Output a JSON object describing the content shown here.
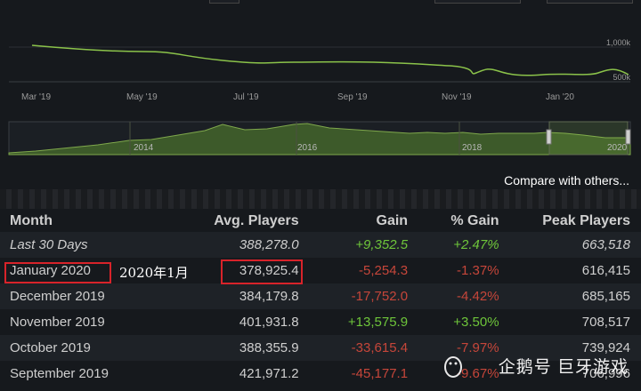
{
  "chart": {
    "yaxis_labels": [
      "1,000k",
      "500k"
    ],
    "xaxis_labels": [
      "Mar '19",
      "May '19",
      "Jul '19",
      "Sep '19",
      "Nov '19",
      "Jan '20"
    ],
    "navigator_labels": [
      "2014",
      "2016",
      "2018",
      "2020"
    ],
    "line_color": "#8bc34a"
  },
  "compare_link": "Compare with others...",
  "table": {
    "headers": [
      "Month",
      "Avg. Players",
      "Gain",
      "% Gain",
      "Peak Players"
    ],
    "rows": [
      {
        "month": "Last 30 Days",
        "avg": "388,278.0",
        "gain": "+9,352.5",
        "pct": "+2.47%",
        "peak": "663,518"
      },
      {
        "month": "January 2020",
        "avg": "378,925.4",
        "gain": "-5,254.3",
        "pct": "-1.37%",
        "peak": "616,415"
      },
      {
        "month": "December 2019",
        "avg": "384,179.8",
        "gain": "-17,752.0",
        "pct": "-4.42%",
        "peak": "685,165"
      },
      {
        "month": "November 2019",
        "avg": "401,931.8",
        "gain": "+13,575.9",
        "pct": "+3.50%",
        "peak": "708,517"
      },
      {
        "month": "October 2019",
        "avg": "388,355.9",
        "gain": "-33,615.4",
        "pct": "-7.97%",
        "peak": "739,924"
      },
      {
        "month": "September 2019",
        "avg": "421,971.2",
        "gain": "-45,177.1",
        "pct": "-9.67%",
        "peak": "706,996"
      }
    ]
  },
  "annotation": "2020年1月",
  "watermark": "企鹅号 巨牙游戏",
  "colors": {
    "highlight": "#d8232a",
    "positive": "#6ec53a",
    "negative": "#c6463a"
  }
}
